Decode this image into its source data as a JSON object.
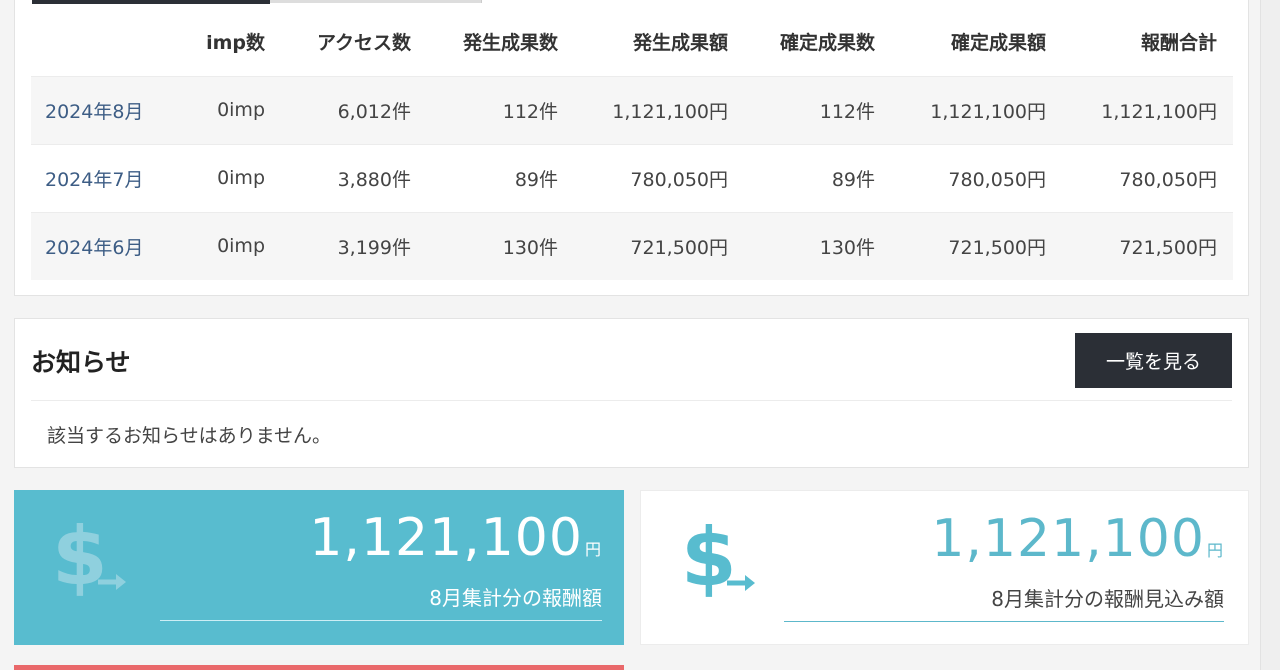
{
  "report": {
    "headers": [
      "",
      "imp数",
      "アクセス数",
      "発生成果数",
      "発生成果額",
      "確定成果数",
      "確定成果額",
      "報酬合計"
    ],
    "rows": [
      {
        "month": "2024年8月",
        "imp": "0imp",
        "access": "6,012件",
        "gen_count": "112件",
        "gen_amount": "1,121,100円",
        "conf_count": "112件",
        "conf_amount": "1,121,100円",
        "total": "1,121,100円"
      },
      {
        "month": "2024年7月",
        "imp": "0imp",
        "access": "3,880件",
        "gen_count": "89件",
        "gen_amount": "780,050円",
        "conf_count": "89件",
        "conf_amount": "780,050円",
        "total": "780,050円"
      },
      {
        "month": "2024年6月",
        "imp": "0imp",
        "access": "3,199件",
        "gen_count": "130件",
        "gen_amount": "721,500円",
        "conf_count": "130件",
        "conf_amount": "721,500円",
        "total": "721,500円"
      }
    ]
  },
  "notice": {
    "title": "お知らせ",
    "button_label": "一覧を見る",
    "empty_text": "該当するお知らせはありません。"
  },
  "cards": {
    "confirmed": {
      "amount": "1,121,100",
      "unit": "円",
      "label": "8月集計分の報酬額",
      "icon": "dollar-transfer-icon"
    },
    "expected": {
      "amount": "1,121,100",
      "unit": "円",
      "label": "8月集計分の報酬見込み額",
      "icon": "dollar-transfer-icon"
    }
  },
  "colors": {
    "accent": "#58bccf",
    "dark_button": "#2b2f36",
    "link": "#3d5d85",
    "alert_strip": "#e9686a"
  }
}
